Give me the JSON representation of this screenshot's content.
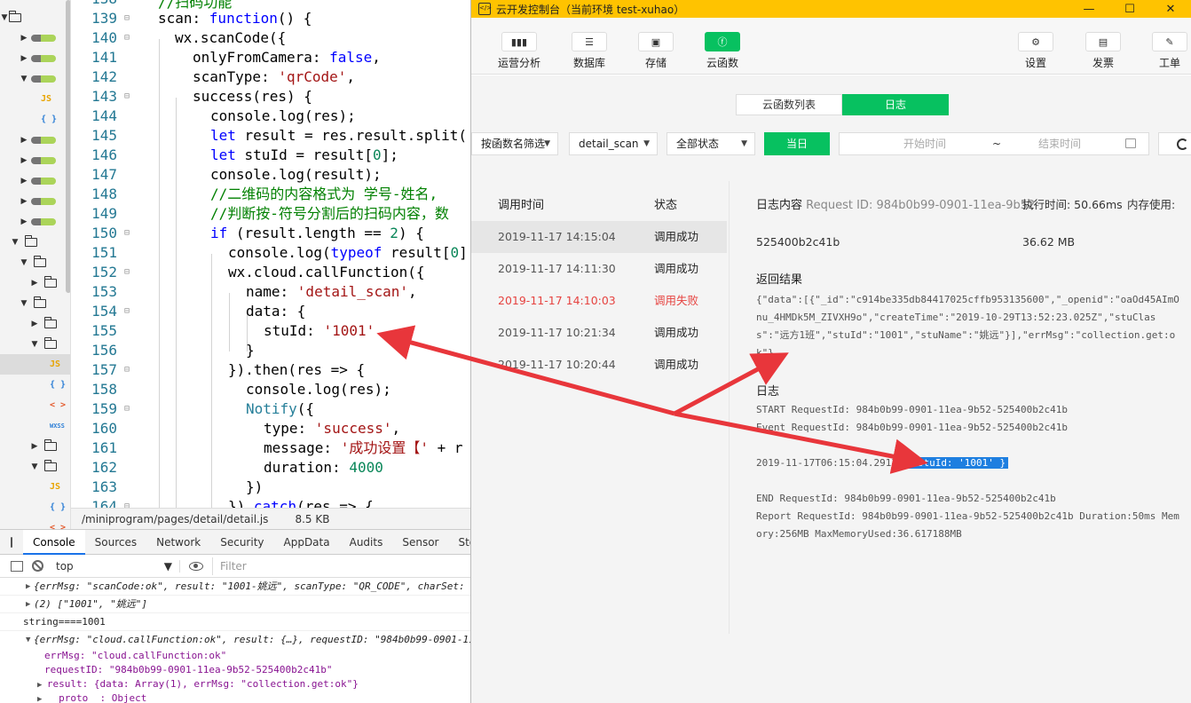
{
  "editor": {
    "file_path": "/miniprogram/pages/detail/detail.js",
    "file_size": "8.5 KB",
    "line_numbers": [
      "138",
      "139",
      "140",
      "141",
      "142",
      "143",
      "144",
      "145",
      "146",
      "147",
      "148",
      "149",
      "150",
      "151",
      "152",
      "153",
      "154",
      "155",
      "156",
      "157",
      "158",
      "159",
      "160",
      "161",
      "162",
      "163",
      "164"
    ]
  },
  "tree": {
    "ext_labels": [
      "JS",
      "{ }",
      "JS",
      "{ }",
      "< >",
      "WXSS",
      "JS",
      "{ }",
      "< >"
    ]
  },
  "devtools": {
    "tabs": [
      "Console",
      "Sources",
      "Network",
      "Security",
      "AppData",
      "Audits",
      "Sensor",
      "Stor"
    ],
    "context": "top",
    "filter_placeholder": "Filter",
    "console_lines": [
      "{errMsg: \"scanCode:ok\", result: \"1001-姚远\", scanType: \"QR_CODE\", charSet:",
      "(2) [\"1001\", \"姚远\"]",
      "string====1001",
      "{errMsg: \"cloud.callFunction:ok\", result: {…}, requestID: \"984b0b99-0901-11",
      "errMsg: \"cloud.callFunction:ok\"",
      "requestID: \"984b0b99-0901-11ea-9b52-525400b2c41b\"",
      "result: {data: Array(1), errMsg: \"collection.get:ok\"}",
      "__proto__: Object"
    ]
  },
  "window": {
    "title": "云开发控制台（当前环境 test-xuhao）",
    "controls": [
      "—",
      "☐",
      "✕"
    ],
    "toolbar_left": [
      {
        "label": "运营分析",
        "icon": "bar-chart-icon"
      },
      {
        "label": "数据库",
        "icon": "database-icon"
      },
      {
        "label": "存储",
        "icon": "storage-icon"
      },
      {
        "label": "云函数",
        "icon": "cloud-function-icon"
      }
    ],
    "toolbar_right": [
      {
        "label": "设置",
        "icon": "gear-icon"
      },
      {
        "label": "发票",
        "icon": "invoice-icon"
      },
      {
        "label": "工单",
        "icon": "ticket-icon"
      }
    ],
    "accent": "#07c160",
    "title_bar_color": "#ffc300"
  },
  "cloud": {
    "segments": [
      "云函数列表",
      "日志"
    ],
    "filter_by_name": "按函数名筛选",
    "function_select": "detail_scan",
    "status_select": "全部状态",
    "today_button": "当日",
    "start_placeholder": "开始时间",
    "range_sep": "~",
    "end_placeholder": "结束时间",
    "list_headers": {
      "time": "调用时间",
      "status": "状态"
    },
    "rows": [
      {
        "time": "2019-11-17 14:15:04",
        "status": "调用成功"
      },
      {
        "time": "2019-11-17 14:11:30",
        "status": "调用成功"
      },
      {
        "time": "2019-11-17 14:10:03",
        "status": "调用失败"
      },
      {
        "time": "2019-11-17 10:21:34",
        "status": "调用成功"
      },
      {
        "time": "2019-11-17 10:20:44",
        "status": "调用成功"
      }
    ],
    "detail": {
      "content_label": "日志内容",
      "request_id_label": "Request ID: 984b0b99-0901-11ea-9b52-",
      "request_id_cont": "525400b2c41b",
      "exec_time": "执行时间: 50.66ms",
      "mem_label": "内存使用:",
      "mem_value": "36.62 MB",
      "return_label": "返回结果",
      "return_value": "{\"data\":[{\"_id\":\"c914be335db84417025cffb953135600\",\"_openid\":\"oaOd45AImOnu_4HMDk5M_ZIVXH9o\",\"createTime\":\"2019-10-29T13:52:23.025Z\",\"stuClass\":\"远方1班\",\"stuId\":\"1001\",\"stuName\":\"姚远\"}],\"errMsg\":\"collection.get:ok\"}",
      "log_label": "日志",
      "log_lines": [
        "START RequestId: 984b0b99-0901-11ea-9b52-525400b2c41b",
        "Event RequestId: 984b0b99-0901-11ea-9b52-525400b2c41b"
      ],
      "log_time": "2019-11-17T06:15:04.291Z",
      "log_highlight": "{ stuId: '1001' }",
      "log_end": "END RequestId: 984b0b99-0901-11ea-9b52-525400b2c41b",
      "log_report": "Report RequestId: 984b0b99-0901-11ea-9b52-525400b2c41b Duration:50ms Memory:256MB MaxMemoryUsed:36.617188MB"
    }
  }
}
